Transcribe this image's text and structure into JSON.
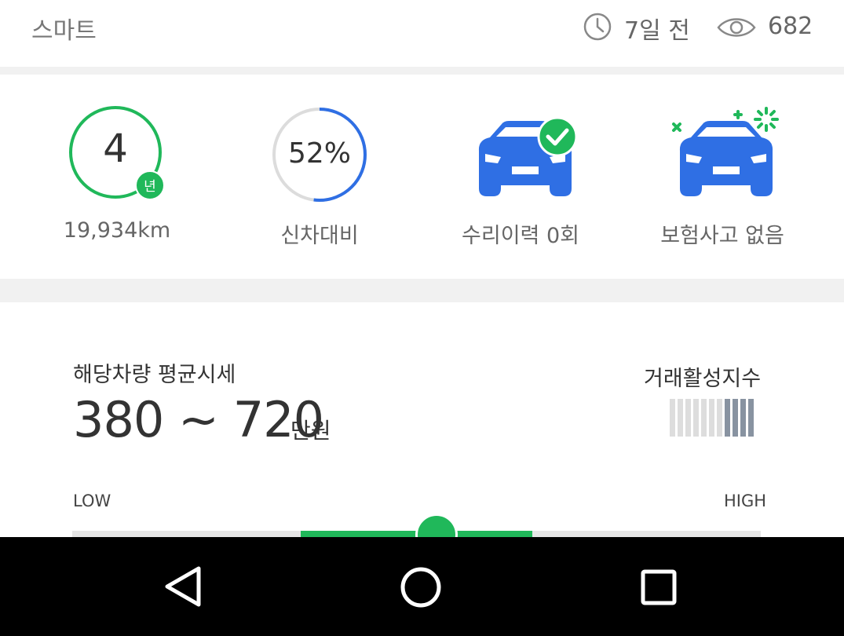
{
  "header": {
    "brand": "스마트",
    "posted_ago": "7일 전",
    "views": "682"
  },
  "summary": {
    "years": "4",
    "years_unit": "년",
    "mileage": "19,934km",
    "new_car_ratio": "52%",
    "new_car_ratio_value": 52,
    "new_car_ratio_label": "신차대비",
    "repair_label": "수리이력 0회",
    "insurance_label": "보험사고 없음"
  },
  "price": {
    "title": "해당차량 평균시세",
    "range": "380 ~ 720",
    "unit": "만원",
    "activity_title": "거래활성지수",
    "activity_level": 4,
    "activity_total": 11,
    "low_label": "LOW",
    "high_label": "HIGH"
  },
  "colors": {
    "accent_green": "#20b85a",
    "car_blue": "#2f6fe4",
    "ratio_track": "#dcdcdc",
    "activity_on": "#8893a1",
    "activity_off": "#dddddd"
  },
  "icons": {
    "clock": "clock-icon",
    "eye": "eye-icon",
    "car_check": "car-check-icon",
    "car_sparkle": "car-sparkle-icon",
    "back": "nav-back-icon",
    "home": "nav-home-icon",
    "recent": "nav-recent-icon"
  }
}
